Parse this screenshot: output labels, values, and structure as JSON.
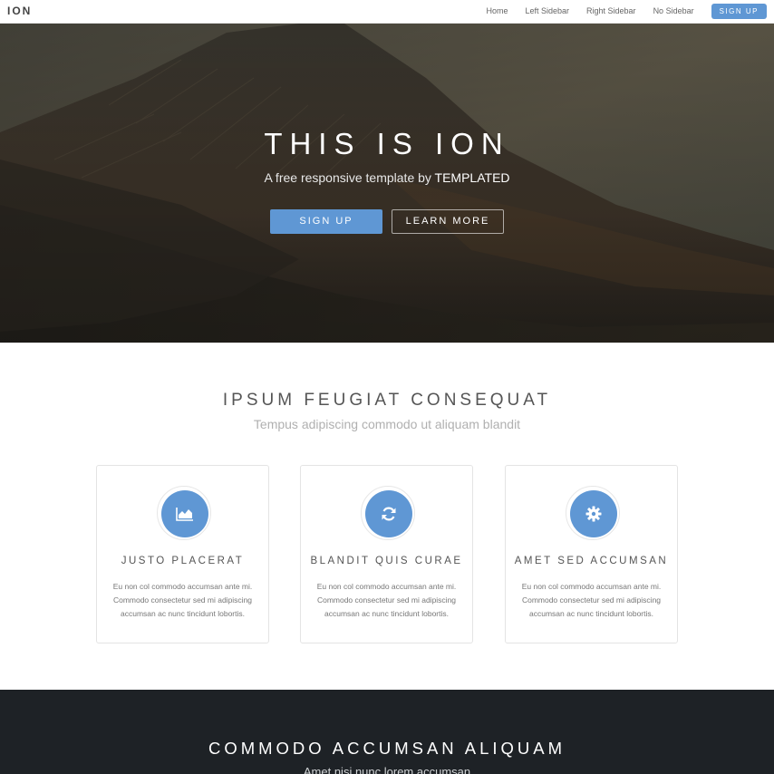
{
  "header": {
    "logo": "ION",
    "nav": [
      {
        "label": "Home"
      },
      {
        "label": "Left Sidebar"
      },
      {
        "label": "Right Sidebar"
      },
      {
        "label": "No Sidebar"
      }
    ],
    "cta": "SIGN UP"
  },
  "banner": {
    "title": "THIS IS ION",
    "subtitle_prefix": "A free responsive template by ",
    "subtitle_brand": "TEMPLATED",
    "primary_button": "SIGN UP",
    "secondary_button": "LEARN MORE"
  },
  "features": {
    "title": "IPSUM FEUGIAT CONSEQUAT",
    "subtitle": "Tempus adipiscing commodo ut aliquam blandit",
    "cards": [
      {
        "icon": "area-chart-icon",
        "title": "JUSTO PLACERAT",
        "text": "Eu non col commodo accumsan ante mi. Commodo consectetur sed mi adipiscing accumsan ac nunc tincidunt lobortis."
      },
      {
        "icon": "refresh-icon",
        "title": "BLANDIT QUIS CURAE",
        "text": "Eu non col commodo accumsan ante mi. Commodo consectetur sed mi adipiscing accumsan ac nunc tincidunt lobortis."
      },
      {
        "icon": "gear-icon",
        "title": "AMET SED ACCUMSAN",
        "text": "Eu non col commodo accumsan ante mi. Commodo consectetur sed mi adipiscing accumsan ac nunc tincidunt lobortis."
      }
    ]
  },
  "dark_section": {
    "title": "COMMODO ACCUMSAN ALIQUAM",
    "subtitle": "Amet nisi nunc lorem accumsan"
  },
  "colors": {
    "accent": "#5f97d4",
    "dark_bg": "#1e2226"
  }
}
